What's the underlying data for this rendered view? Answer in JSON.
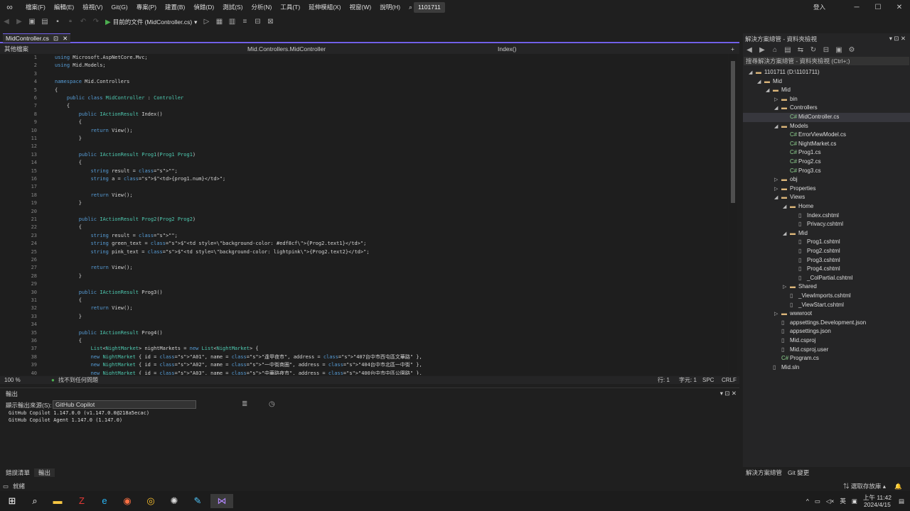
{
  "menu": [
    "檔案(F)",
    "編輯(E)",
    "檢視(V)",
    "Git(G)",
    "專案(P)",
    "建置(B)",
    "偵錯(D)",
    "測試(S)",
    "分析(N)",
    "工具(T)",
    "延伸模組(X)",
    "視窗(W)",
    "說明(H)"
  ],
  "search_label": "搜尋",
  "solution_badge": "1101711",
  "signin": "登入",
  "run_label": "目前的文件 (MidController.cs)",
  "active_tab": "MidController.cs",
  "nav": {
    "project": "其他檔案",
    "class": "Mid.Controllers.MidController",
    "member": "Index()"
  },
  "code": [
    {
      "n": "1",
      "t": "using Microsoft.AspNetCore.Mvc;"
    },
    {
      "n": "2",
      "t": "using Mid.Models;"
    },
    {
      "n": "3",
      "t": ""
    },
    {
      "n": "4",
      "t": "namespace Mid.Controllers"
    },
    {
      "n": "5",
      "t": "{"
    },
    {
      "n": "6",
      "t": "    public class MidController : Controller"
    },
    {
      "n": "7",
      "t": "    {"
    },
    {
      "n": "8",
      "t": "        public IActionResult Index()"
    },
    {
      "n": "9",
      "t": "        {"
    },
    {
      "n": "10",
      "t": "            return View();"
    },
    {
      "n": "11",
      "t": "        }"
    },
    {
      "n": "12",
      "t": ""
    },
    {
      "n": "13",
      "t": "        public IActionResult Prog1(Prog1 Prog1)"
    },
    {
      "n": "14",
      "t": "        {"
    },
    {
      "n": "15",
      "t": "            string result = \"\";"
    },
    {
      "n": "16",
      "t": "            string a = $\"<td>{prog1.num}</td>\";"
    },
    {
      "n": "17",
      "t": ""
    },
    {
      "n": "18",
      "t": "            return View();"
    },
    {
      "n": "19",
      "t": "        }"
    },
    {
      "n": "20",
      "t": ""
    },
    {
      "n": "21",
      "t": "        public IActionResult Prog2(Prog2 Prog2)"
    },
    {
      "n": "22",
      "t": "        {"
    },
    {
      "n": "23",
      "t": "            string result = \"\";"
    },
    {
      "n": "24",
      "t": "            string green_text = $\"<td style=\\\"background-color: #edf8cf\\\">{Prog2.text1}</td>\";"
    },
    {
      "n": "25",
      "t": "            string pink_text = $\"<td style=\\\"background-color: lightpink\\\">{Prog2.text2}</td>\";"
    },
    {
      "n": "26",
      "t": ""
    },
    {
      "n": "27",
      "t": "            return View();"
    },
    {
      "n": "28",
      "t": "        }"
    },
    {
      "n": "29",
      "t": ""
    },
    {
      "n": "30",
      "t": "        public IActionResult Prog3()"
    },
    {
      "n": "31",
      "t": "        {"
    },
    {
      "n": "32",
      "t": "            return View();"
    },
    {
      "n": "33",
      "t": "        }"
    },
    {
      "n": "34",
      "t": ""
    },
    {
      "n": "35",
      "t": "        public IActionResult Prog4()"
    },
    {
      "n": "36",
      "t": "        {"
    },
    {
      "n": "37",
      "t": "            List<NightMarket> nightMarkets = new List<NightMarket> {"
    },
    {
      "n": "38",
      "t": "            new NightMarket { id = \"A01\", name = \"逢甲夜市\", address = \"407台中市西屯區文華路\" },"
    },
    {
      "n": "39",
      "t": "            new NightMarket { id = \"A02\", name = \"一中街商圈\", address = \"404台中市北區一中街\" },"
    },
    {
      "n": "40",
      "t": "            new NightMarket { id = \"A03\", name = \"中華路夜市\", address = \"400台中市中區公園路\" },"
    }
  ],
  "editor_status": {
    "zoom": "100 %",
    "issues": "找不到任何問題",
    "line": "行: 1",
    "col": "字元: 1",
    "spc": "SPC",
    "crlf": "CRLF"
  },
  "output": {
    "title": "輸出",
    "source_label": "顯示輸出來源(S):",
    "source": "GitHub Copilot",
    "lines": [
      "GitHub Copilot 1.147.0.0 (v1.147.0.0@218a5ecac)",
      "GitHub Copilot Agent 1.147.0 (1.147.0)"
    ]
  },
  "bottom_tabs": [
    "錯誤清單",
    "輸出"
  ],
  "solution_explorer": {
    "title": "解決方案總管 - 資料夾檢視",
    "search": "搜尋解決方案總管 - 資料夾檢視 (Ctrl+;)",
    "items": [
      {
        "label": "1101711 (D:\\1101711)",
        "depth": 0,
        "arrow": "◢",
        "icon": "folder"
      },
      {
        "label": "Mid",
        "depth": 1,
        "arrow": "◢",
        "icon": "folder"
      },
      {
        "label": "Mid",
        "depth": 2,
        "arrow": "◢",
        "icon": "folder"
      },
      {
        "label": "bin",
        "depth": 3,
        "arrow": "▷",
        "icon": "folder"
      },
      {
        "label": "Controllers",
        "depth": 3,
        "arrow": "◢",
        "icon": "folder"
      },
      {
        "label": "MidController.cs",
        "depth": 4,
        "arrow": "",
        "icon": "cs",
        "selected": true
      },
      {
        "label": "Models",
        "depth": 3,
        "arrow": "◢",
        "icon": "folder"
      },
      {
        "label": "ErrorViewModel.cs",
        "depth": 4,
        "arrow": "",
        "icon": "cs"
      },
      {
        "label": "NightMarket.cs",
        "depth": 4,
        "arrow": "",
        "icon": "cs"
      },
      {
        "label": "Prog1.cs",
        "depth": 4,
        "arrow": "",
        "icon": "cs"
      },
      {
        "label": "Prog2.cs",
        "depth": 4,
        "arrow": "",
        "icon": "cs"
      },
      {
        "label": "Prog3.cs",
        "depth": 4,
        "arrow": "",
        "icon": "cs"
      },
      {
        "label": "obj",
        "depth": 3,
        "arrow": "▷",
        "icon": "folder"
      },
      {
        "label": "Properties",
        "depth": 3,
        "arrow": "▷",
        "icon": "folder"
      },
      {
        "label": "Views",
        "depth": 3,
        "arrow": "◢",
        "icon": "folder"
      },
      {
        "label": "Home",
        "depth": 4,
        "arrow": "◢",
        "icon": "folder"
      },
      {
        "label": "Index.cshtml",
        "depth": 5,
        "arrow": "",
        "icon": "file"
      },
      {
        "label": "Privacy.cshtml",
        "depth": 5,
        "arrow": "",
        "icon": "file"
      },
      {
        "label": "Mid",
        "depth": 4,
        "arrow": "◢",
        "icon": "folder"
      },
      {
        "label": "Prog1.cshtml",
        "depth": 5,
        "arrow": "",
        "icon": "file"
      },
      {
        "label": "Prog2.cshtml",
        "depth": 5,
        "arrow": "",
        "icon": "file"
      },
      {
        "label": "Prog3.cshtml",
        "depth": 5,
        "arrow": "",
        "icon": "file"
      },
      {
        "label": "Prog4.cshtml",
        "depth": 5,
        "arrow": "",
        "icon": "file"
      },
      {
        "label": "_ColPartial.cshtml",
        "depth": 5,
        "arrow": "",
        "icon": "file"
      },
      {
        "label": "Shared",
        "depth": 4,
        "arrow": "▷",
        "icon": "folder"
      },
      {
        "label": "_ViewImports.cshtml",
        "depth": 4,
        "arrow": "",
        "icon": "file"
      },
      {
        "label": "_ViewStart.cshtml",
        "depth": 4,
        "arrow": "",
        "icon": "file"
      },
      {
        "label": "wwwroot",
        "depth": 3,
        "arrow": "▷",
        "icon": "folder"
      },
      {
        "label": "appsettings.Development.json",
        "depth": 3,
        "arrow": "",
        "icon": "file"
      },
      {
        "label": "appsettings.json",
        "depth": 3,
        "arrow": "",
        "icon": "file"
      },
      {
        "label": "Mid.csproj",
        "depth": 3,
        "arrow": "",
        "icon": "file"
      },
      {
        "label": "Mid.csproj.user",
        "depth": 3,
        "arrow": "",
        "icon": "file"
      },
      {
        "label": "Program.cs",
        "depth": 3,
        "arrow": "",
        "icon": "cs"
      },
      {
        "label": "Mid.sln",
        "depth": 2,
        "arrow": "",
        "icon": "file"
      }
    ],
    "footer_tabs": [
      "解決方案總管",
      "Git 變更"
    ]
  },
  "status": {
    "ready": "就緒",
    "source_control": "選取存放庫"
  },
  "tray": {
    "lang": "英",
    "time": "上午 11:42",
    "date": "2024/4/15"
  }
}
